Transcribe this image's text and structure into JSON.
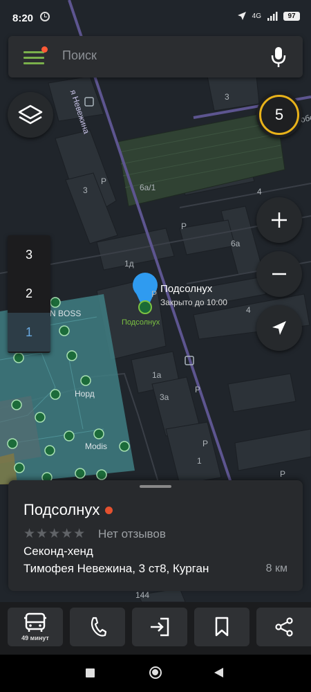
{
  "status_bar": {
    "time": "8:20",
    "network": "4G",
    "battery": "97"
  },
  "search": {
    "placeholder": "Поиск"
  },
  "map": {
    "notification_count": "5",
    "floors": [
      "3",
      "2",
      "1"
    ],
    "active_floor": "1",
    "pin": {
      "name": "Подсолнух",
      "status": "Закрыто до 10:00",
      "small_label": "Подсолнух",
      "color": "#2f9bf0"
    },
    "street_labels": {
      "nevezhina": "я Невежина",
      "pobedy": "Побе"
    },
    "labels": {
      "b3a": "3",
      "b3b": "3",
      "b6a1": "6а/1",
      "b4a": "4",
      "b6a": "6а",
      "b1d": "1д",
      "b4b": "4",
      "b1a": "1а",
      "b3a2": "3а",
      "b1": "1",
      "b144": "144",
      "boss": "N BOSS",
      "nord": "Норд",
      "modis": "Modis",
      "p1": "P",
      "p2": "P",
      "p3": "P",
      "p4": "P",
      "p5": "P",
      "p6": "P"
    }
  },
  "card": {
    "title": "Подсолнух",
    "stars": "★★★★★",
    "reviews": "Нет отзывов",
    "category": "Секонд-хенд",
    "address": "Тимофея Невежина, 3 ст8, Курган",
    "distance": "8 км"
  },
  "actions": {
    "route_label": "49 минут"
  },
  "colors": {
    "accent_green": "#7ab04b",
    "counter_ring": "#e8b21a",
    "closed": "#e4512f",
    "pin": "#2f9bf0"
  }
}
